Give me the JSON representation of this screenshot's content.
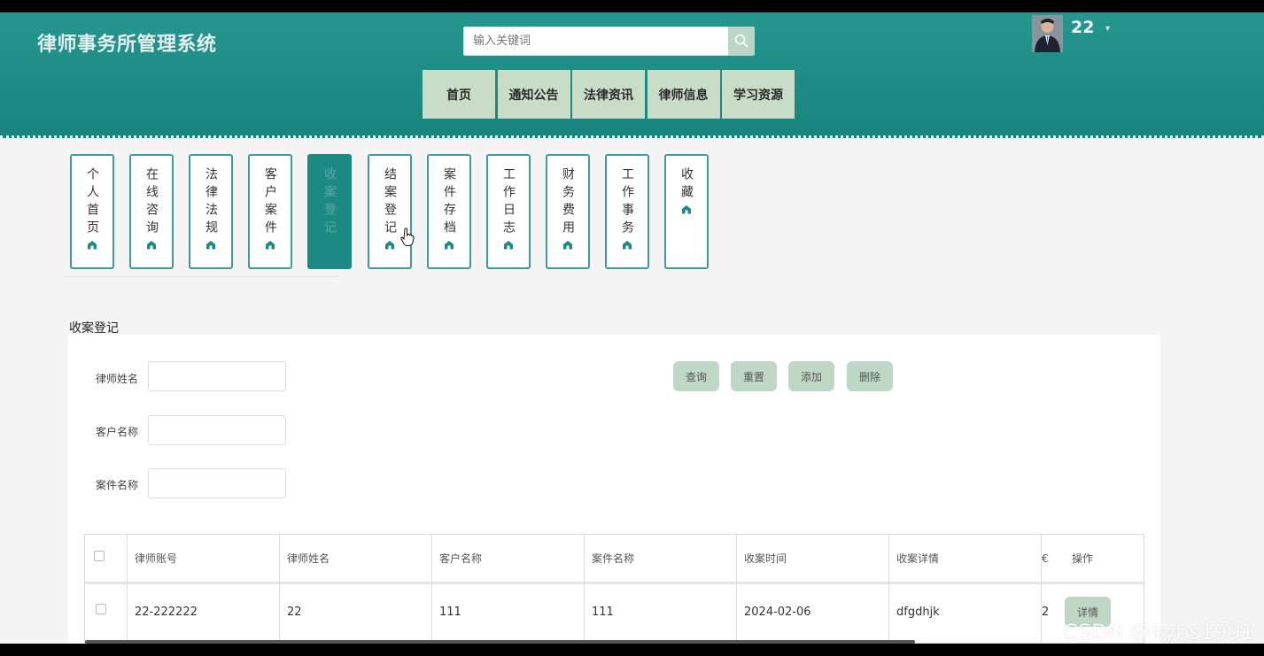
{
  "header": {
    "site_title": "律师事务所管理系统",
    "search_placeholder": "输入关键词",
    "username": "22",
    "user_caret": "▾",
    "nav": [
      "首页",
      "通知公告",
      "法律资讯",
      "律师信息",
      "学习资源"
    ]
  },
  "tabs": [
    {
      "label": "个人首页",
      "active": false
    },
    {
      "label": "在线咨询",
      "active": false
    },
    {
      "label": "法律法规",
      "active": false
    },
    {
      "label": "客户案件",
      "active": false
    },
    {
      "label": "收案登记",
      "active": true
    },
    {
      "label": "结案登记",
      "active": false
    },
    {
      "label": "案件存档",
      "active": false
    },
    {
      "label": "工作日志",
      "active": false
    },
    {
      "label": "财务费用",
      "active": false
    },
    {
      "label": "工作事务",
      "active": false
    },
    {
      "label": "收藏",
      "active": false
    }
  ],
  "section_title": "收案登记",
  "form": {
    "lawyer_name_label": "律师姓名",
    "client_name_label": "客户名称",
    "case_name_label": "案件名称"
  },
  "buttons": {
    "query": "查询",
    "reset": "重置",
    "add": "添加",
    "delete": "删除",
    "detail": "详情"
  },
  "table": {
    "headers": [
      "律师账号",
      "律师姓名",
      "客户名称",
      "案件名称",
      "收案时间",
      "收案详情",
      "€",
      "操作"
    ],
    "rows": [
      [
        "22-222222",
        "22",
        "111",
        "111",
        "2024-02-06",
        "dfgdhjk",
        "2"
      ]
    ]
  },
  "watermark": "CSDN @kybs1991",
  "colors": {
    "header_teal": "#1a8a83",
    "nav_bg": "#c9dcc8",
    "button_green": "#bfd8c5",
    "active_tab": "#1b8a82"
  }
}
